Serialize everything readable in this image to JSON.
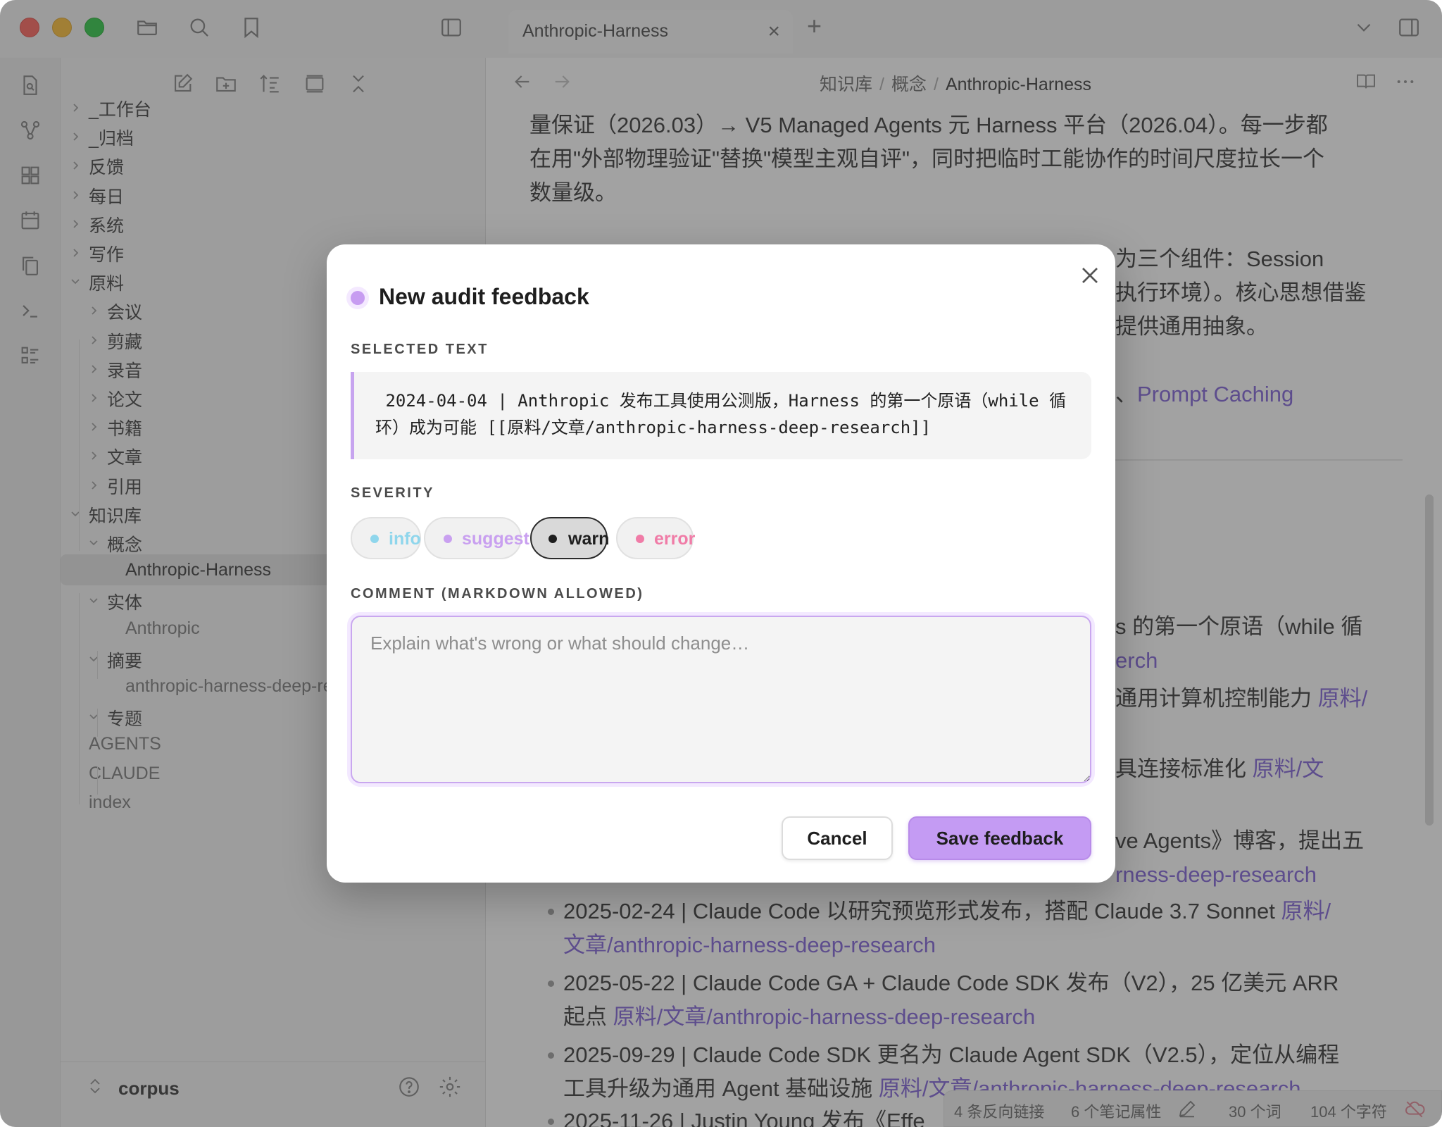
{
  "titlebar": {
    "tab_title": "Anthropic-Harness",
    "tab_add": "+",
    "tab_close": "×"
  },
  "explorer": {
    "items": [
      {
        "label": "_工作台",
        "chevron": "right"
      },
      {
        "label": "_归档",
        "chevron": "right"
      },
      {
        "label": "反馈",
        "chevron": "right"
      },
      {
        "label": "每日",
        "chevron": "right"
      },
      {
        "label": "系统",
        "chevron": "right"
      },
      {
        "label": "写作",
        "chevron": "right"
      },
      {
        "label": "原料",
        "chevron": "down"
      },
      {
        "label": "会议",
        "chevron": "right"
      },
      {
        "label": "剪藏",
        "chevron": "right"
      },
      {
        "label": "录音",
        "chevron": "right"
      },
      {
        "label": "论文",
        "chevron": "right"
      },
      {
        "label": "书籍",
        "chevron": "right"
      },
      {
        "label": "文章",
        "chevron": "right"
      },
      {
        "label": "引用",
        "chevron": "right"
      },
      {
        "label": "知识库",
        "chevron": "down"
      },
      {
        "label": "概念",
        "chevron": "down"
      },
      {
        "label": "Anthropic-Harness",
        "chevron": "none",
        "active": true
      },
      {
        "label": "实体",
        "chevron": "down"
      },
      {
        "label": "Anthropic",
        "chevron": "none"
      },
      {
        "label": "摘要",
        "chevron": "down"
      },
      {
        "label": "anthropic-harness-deep-rese...",
        "chevron": "none"
      },
      {
        "label": "专题",
        "chevron": "down"
      },
      {
        "label": "AGENTS",
        "chevron": "none"
      },
      {
        "label": "CLAUDE",
        "chevron": "none"
      },
      {
        "label": "index",
        "chevron": "none"
      }
    ],
    "vault_name": "corpus"
  },
  "editor": {
    "breadcrumb": [
      "知识库",
      "概念",
      "Anthropic-Harness"
    ],
    "breadcrumb_sep": "/",
    "lines": {
      "l1": "量保证（2026.03）→ V5 Managed Agents 元 Harness 平台（2026.04）。每一步都",
      "l2": "在用\"外部物理验证\"替换\"模型主观自评\"，同时把临时工能协作的时间尺度拉长一个",
      "l3": "数量级。",
      "l4": "为三个组件：Session",
      "l5": "执行环境）。核心思想借鉴",
      "l6": "提供通用抽象。",
      "l7_sep": "、",
      "l7_link": "Prompt Caching",
      "l8": "s 的第一个原语（while 循",
      "l9_link": "erch",
      "l10": "通用计算机控制能力 ",
      "l10_link": "原料/",
      "l11": "具连接标准化 ",
      "l11_link": "原料/文",
      "l12": "ve Agents》博客，提出五",
      "l13_link": "rness-deep-research",
      "b1_text": "2025-02-24 | Claude Code 以研究预览形式发布，搭配 Claude 3.7 Sonnet ",
      "b1_link": "原料/",
      "b1_link2": "文章/anthropic-harness-deep-research",
      "b2_text": "2025-05-22 | Claude Code GA + Claude Code SDK 发布（V2），25 亿美元 ARR",
      "b2_text2": "起点 ",
      "b2_link": "原料/文章/anthropic-harness-deep-research",
      "b3_text": "2025-09-29 | Claude Code SDK 更名为 Claude Agent SDK（V2.5），定位从编程",
      "b3_text2": "工具升级为通用 Agent 基础设施 ",
      "b3_link": "原料/文章/anthropic-harness-deep-research",
      "b4_text": "2025-11-26 | Justin Young 发布《Effe"
    }
  },
  "status": {
    "backlinks": "4 条反向链接",
    "properties": "6 个笔记属性",
    "words": "30 个词",
    "chars": "104 个字符"
  },
  "modal": {
    "title": "New audit feedback",
    "selected_text_label": "SELECTED TEXT",
    "selected_text": " 2024-04-04 | Anthropic 发布工具使用公测版，Harness 的第一个原语（while 循环）成为可能 [[原料/文章/anthropic-harness-deep-research]]",
    "severity_label": "SEVERITY",
    "severities": [
      {
        "label": "info",
        "color": "#8fd6ec"
      },
      {
        "label": "suggest",
        "color": "#c9a0f0"
      },
      {
        "label": "warn",
        "color": "#1e1e1e",
        "selected": true
      },
      {
        "label": "error",
        "color": "#f07ca7"
      }
    ],
    "comment_label": "COMMENT (MARKDOWN ALLOWED)",
    "comment_placeholder": "Explain what's wrong or what should change…",
    "comment_value": "",
    "cancel_label": "Cancel",
    "save_label": "Save feedback",
    "accent_color": "#c49bf3"
  }
}
